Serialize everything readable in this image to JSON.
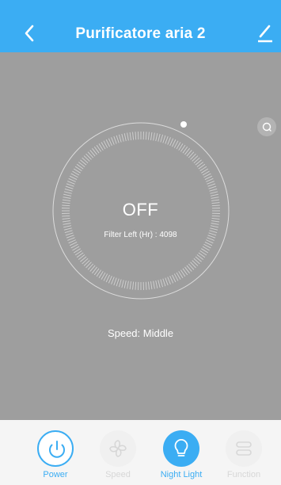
{
  "header": {
    "title": "Purificatore aria 2",
    "back_icon": "chevron-left-icon",
    "edit_icon": "pencil-icon"
  },
  "status": {
    "state": "OFF",
    "filter_left": "Filter Left (Hr) : 4098",
    "speed": "Speed: Middle"
  },
  "side_button": {
    "icon": "timer-icon"
  },
  "bottom_bar": {
    "buttons": [
      {
        "label": "Power",
        "icon": "power-icon",
        "active": true
      },
      {
        "label": "Speed",
        "icon": "fan-icon",
        "active": false
      },
      {
        "label": "Night Light",
        "icon": "light-bulb-icon",
        "active": true
      },
      {
        "label": "Function",
        "icon": "function-icon",
        "active": false
      }
    ]
  },
  "colors": {
    "accent": "#3badf3",
    "main_background": "#9e9e9e",
    "bar_background": "#f5f5f5",
    "disabled": "#d7d7d7"
  }
}
